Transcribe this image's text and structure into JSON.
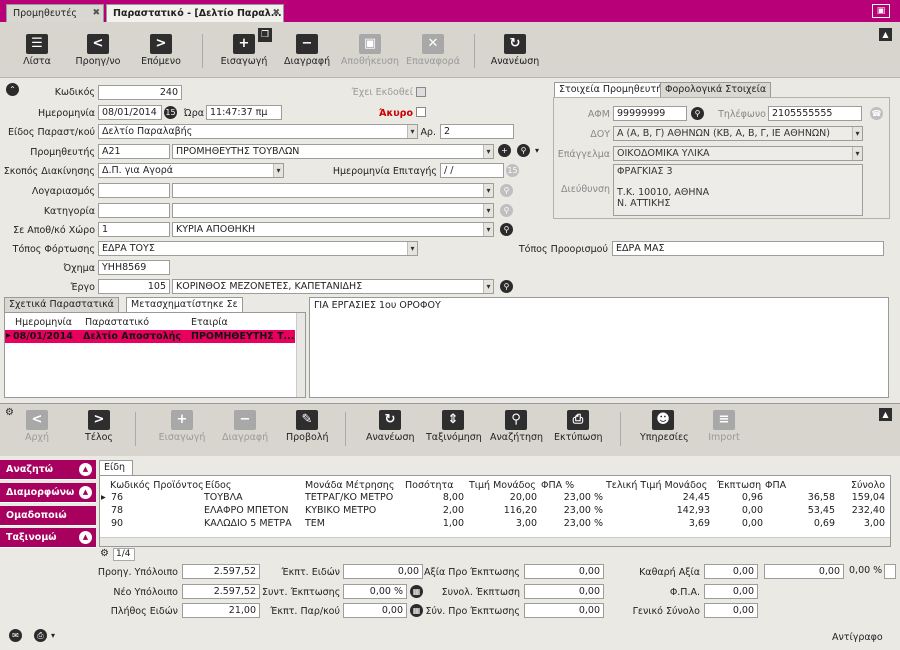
{
  "tabs": [
    {
      "label": "Προμηθευτές"
    },
    {
      "label": "Παραστατικό - [Δελτίο Παραλ..."
    }
  ],
  "toolbar": {
    "list": "Λίστα",
    "prev": "Προηγ/νο",
    "next": "Επόμενο",
    "add": "Εισαγωγή",
    "delete": "Διαγραφή",
    "save": "Αποθήκευση",
    "restore": "Επαναφορά",
    "refresh": "Ανανέωση"
  },
  "form": {
    "code_label": "Κωδικός",
    "code": "240",
    "issued_label": "Έχει Εκδοθεί",
    "date_label": "Ημερομηνία",
    "date": "08/01/2014",
    "time_label": "Ώρα",
    "time": "11:47:37 πμ",
    "void_label": "Άκυρο",
    "doctype_label": "Είδος Παραστ/κού",
    "doctype": "Δελτίο Παραλαβής",
    "num_label": "Αρ.",
    "num": "2",
    "supplier_label": "Προμηθευτής",
    "supplier_code": "Α21",
    "supplier_name": "ΠΡΟΜΗΘΕΥΤΗΣ ΤΟΥΒΛΩΝ",
    "purpose_label": "Σκοπός Διακίνησης",
    "purpose": "Δ.Π. για Αγορά",
    "check_date_label": "Ημερομηνία Επιταγής",
    "check_date": " / /",
    "account_label": "Λογαριασμός",
    "category_label": "Κατηγορία",
    "warehouse_label": "Σε Αποθ/κό Χώρο",
    "warehouse_code": "1",
    "warehouse": "ΚΥΡΙΑ ΑΠΟΘΗΚΗ",
    "load_label": "Τόπος Φόρτωσης",
    "load": "ΕΔΡΑ ΤΟΥΣ",
    "dest_label": "Τόπος Προορισμού",
    "dest": "ΕΔΡΑ ΜΑΣ",
    "vehicle_label": "Όχημα",
    "vehicle": "ΥΗΗ8569",
    "project_label": "Έργο",
    "project_code": "105",
    "project": "ΚΟΡΙΝΘΟΣ ΜΕΖΟΝΕΤΕΣ, ΚΑΠΕΤΑΝΙΔΗΣ"
  },
  "supplier_panel": {
    "tab1": "Στοιχεία Προμηθευτή",
    "tab2": "Φορολογικά Στοιχεία",
    "afm_label": "ΑΦΜ",
    "afm": "99999999",
    "phone_label": "Τηλέφωνο",
    "phone": "2105555555",
    "doy_label": "ΔΟΥ",
    "doy": "Α (Α, Β, Γ) ΑΘΗΝΩΝ (ΚΒ, Α, Β, Γ, ΙΕ ΑΘΗΝΩΝ)",
    "job_label": "Επάγγελμα",
    "job": "ΟΙΚΟΔΟΜΙΚΑ ΥΛΙΚΑ",
    "address_label": "Διεύθυνση",
    "address1": "ΦΡΑΓΚΙΑΣ 3",
    "address2": "Τ.Κ. 10010, ΑΘΗΝΑ",
    "address3": "Ν. ΑΤΤΙΚΗΣ"
  },
  "related": {
    "tab1": "Σχετικά Παραστατικά",
    "tab2": "Μετασχηματίστηκε Σε",
    "h_date": "Ημερομηνία",
    "h_doc": "Παραστατικό",
    "h_company": "Εταιρία",
    "r_date": "08/01/2014",
    "r_doc": "Δελτίο Αποστολής",
    "r_company": "ΠΡΟΜΗΘΕΥΤΗΣ Τ..."
  },
  "notes": "ΓΙΑ ΕΡΓΑΣΙΕΣ 1ου ΟΡΟΦΟΥ",
  "toolbar2": {
    "first": "Αρχή",
    "last": "Τέλος",
    "add": "Εισαγωγή",
    "delete": "Διαγραφή",
    "view": "Προβολή",
    "refresh": "Ανανέωση",
    "sort": "Ταξινόμηση",
    "search": "Αναζήτηση",
    "print": "Εκτύπωση",
    "services": "Υπηρεσίες",
    "import": "Import"
  },
  "side": {
    "search": "Αναζητώ",
    "format": "Διαμορφώνω",
    "group": "Ομαδοποιώ",
    "sort": "Ταξινομώ"
  },
  "items": {
    "tab": "Είδη",
    "headers": {
      "code": "Κωδικός Προϊόντος",
      "kind": "Είδος",
      "unit": "Μονάδα Μέτρησης",
      "qty": "Ποσότητα",
      "price": "Τιμή Μονάδος",
      "vatp": "ΦΠΑ %",
      "final": "Τελική Τιμή Μονάδος",
      "disc": "Έκπτωση",
      "vat": "ΦΠΑ",
      "total": "Σύνολο"
    },
    "rows": [
      {
        "code": "76",
        "kind": "ΤΟΥΒΛΑ",
        "unit": "ΤΕΤΡΑΓ/ΚΟ ΜΕΤΡΟ",
        "qty": "8,00",
        "price": "20,00",
        "vatp": "23,00 %",
        "final": "24,45",
        "disc": "0,96",
        "vat": "36,58",
        "total": "159,04"
      },
      {
        "code": "78",
        "kind": "ΕΛΑΦΡΟ ΜΠΕΤΟΝ",
        "unit": "ΚΥΒΙΚΟ ΜΕΤΡΟ",
        "qty": "2,00",
        "price": "116,20",
        "vatp": "23,00 %",
        "final": "142,93",
        "disc": "0,00",
        "vat": "53,45",
        "total": "232,40"
      },
      {
        "code": "90",
        "kind": "ΚΑΛΩΔΙΟ 5 ΜΕΤΡΑ",
        "unit": "ΤΕΜ",
        "qty": "1,00",
        "price": "3,00",
        "vatp": "23,00 %",
        "final": "3,69",
        "disc": "0,00",
        "vat": "0,69",
        "total": "3,00"
      }
    ],
    "page": "1/4"
  },
  "totals": {
    "prev_bal_label": "Προηγ. Υπόλοιπο",
    "prev_bal": "2.597,52",
    "new_bal_label": "Νέο Υπόλοιπο",
    "new_bal": "2.597,52",
    "count_label": "Πλήθος Ειδών",
    "count": "21,00",
    "item_disc_label": "Έκπτ. Ειδών",
    "item_disc": "0,00",
    "comp_disc_label": "Συντ. Έκπτωσης",
    "comp_disc": "0,00 %",
    "doc_disc_label": "Έκπτ. Παρ/κού",
    "doc_disc": "0,00",
    "val_before_label": "Αξία Προ Έκπτωσης",
    "val_before": "0,00",
    "tot_disc_label": "Συνολ. Έκπτωση",
    "tot_disc": "0,00",
    "sum_before_label": "Σύν. Προ Έκπτωσης",
    "sum_before": "0,00",
    "net_label": "Καθαρή Αξία",
    "net": "0,00",
    "vat_label": "Φ.Π.Α.",
    "vat": "0,00",
    "grand_label": "Γενικό Σύνολο",
    "grand": "0,00",
    "extra": "0,00",
    "extra_pct": "0,00 %"
  },
  "footer": {
    "copy": "Αντίγραφο"
  }
}
